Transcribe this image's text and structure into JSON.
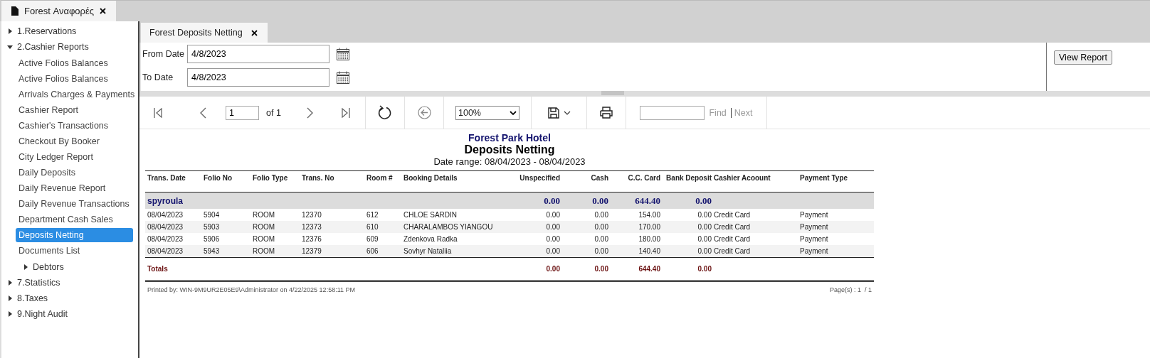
{
  "app_tab": {
    "label": "Forest Αναφορές"
  },
  "sidebar": {
    "items": [
      {
        "kind": "folder",
        "label": "1.Reservations",
        "expanded": false
      },
      {
        "kind": "folder",
        "label": "2.Cashier Reports",
        "expanded": true,
        "children": [
          {
            "kind": "report",
            "label": "Active Folios Balances",
            "selected": false
          },
          {
            "kind": "report",
            "label": "Active Folios Balances",
            "selected": false
          },
          {
            "kind": "report",
            "label": "Arrivals Charges & Payments",
            "selected": false
          },
          {
            "kind": "report",
            "label": "Cashier Report",
            "selected": false
          },
          {
            "kind": "report",
            "label": "Cashier's Transactions",
            "selected": false
          },
          {
            "kind": "report",
            "label": "Checkout By Booker",
            "selected": false
          },
          {
            "kind": "report",
            "label": "City Ledger Report",
            "selected": false
          },
          {
            "kind": "report",
            "label": "Daily Deposits",
            "selected": false
          },
          {
            "kind": "report",
            "label": "Daily Revenue Report",
            "selected": false
          },
          {
            "kind": "report",
            "label": "Daily Revenue Transactions",
            "selected": false
          },
          {
            "kind": "report",
            "label": "Department Cash Sales",
            "selected": false
          },
          {
            "kind": "report",
            "label": "Deposits Netting",
            "selected": true
          },
          {
            "kind": "report",
            "label": "Documents List",
            "selected": false
          },
          {
            "kind": "folder",
            "label": "Debtors",
            "expanded": false
          }
        ]
      },
      {
        "kind": "folder",
        "label": "7.Statistics",
        "expanded": false
      },
      {
        "kind": "folder",
        "label": "8.Taxes",
        "expanded": false
      },
      {
        "kind": "folder",
        "label": "9.Night Audit",
        "expanded": false
      }
    ]
  },
  "report_tab": {
    "label": "Forest Deposits Netting"
  },
  "parameters": [
    {
      "label": "From Date",
      "value": "4/8/2023"
    },
    {
      "label": "To Date",
      "value": "4/8/2023"
    }
  ],
  "view_report_button": "View Report",
  "toolbar": {
    "page": "1",
    "page_count": "of 1",
    "zoom": "100%",
    "find_label": "Find",
    "next_label": "Next",
    "find_disabled": true
  },
  "report": {
    "hotel": "Forest Park Hotel",
    "title": "Deposits Netting",
    "date_range": "Date range: 08/04/2023 - 08/04/2023",
    "columns": [
      "Trans. Date",
      "Folio No",
      "Folio Type",
      "Trans. No",
      "Room #",
      "Booking Details",
      "Unspecified",
      "Cash",
      "C.C. Card",
      "Bank Deposit",
      "Cashier Acoount",
      "Payment Type"
    ],
    "group": {
      "name": "spyroula",
      "totals": [
        "0.00",
        "0.00",
        "644.40",
        "0.00"
      ]
    },
    "rows": [
      [
        "08/04/2023",
        "5904",
        "ROOM",
        "12370",
        "612",
        "CHLOE SARDIN",
        "0.00",
        "0.00",
        "154.00",
        "0.00",
        "Credit Card",
        "Payment"
      ],
      [
        "08/04/2023",
        "5903",
        "ROOM",
        "12373",
        "610",
        "CHARALAMBOS YIANGOU",
        "0.00",
        "0.00",
        "170.00",
        "0.00",
        "Credit Card",
        "Payment"
      ],
      [
        "08/04/2023",
        "5906",
        "ROOM",
        "12376",
        "609",
        "Zdenkova Radka",
        "0.00",
        "0.00",
        "180.00",
        "0.00",
        "Credit Card",
        "Payment"
      ],
      [
        "08/04/2023",
        "5943",
        "ROOM",
        "12379",
        "606",
        "Sovhyr Nataliia",
        "0.00",
        "0.00",
        "140.40",
        "0.00",
        "Credit Card",
        "Payment"
      ]
    ],
    "totals": {
      "label": "Totals",
      "values": [
        "0.00",
        "0.00",
        "644.40",
        "0.00"
      ]
    },
    "printed_by": "Printed by: WIN-9M9UR2E05E9\\Administrator on 4/22/2025 12:58:11 PM",
    "pages": "Page(s) : 1  / 1"
  }
}
